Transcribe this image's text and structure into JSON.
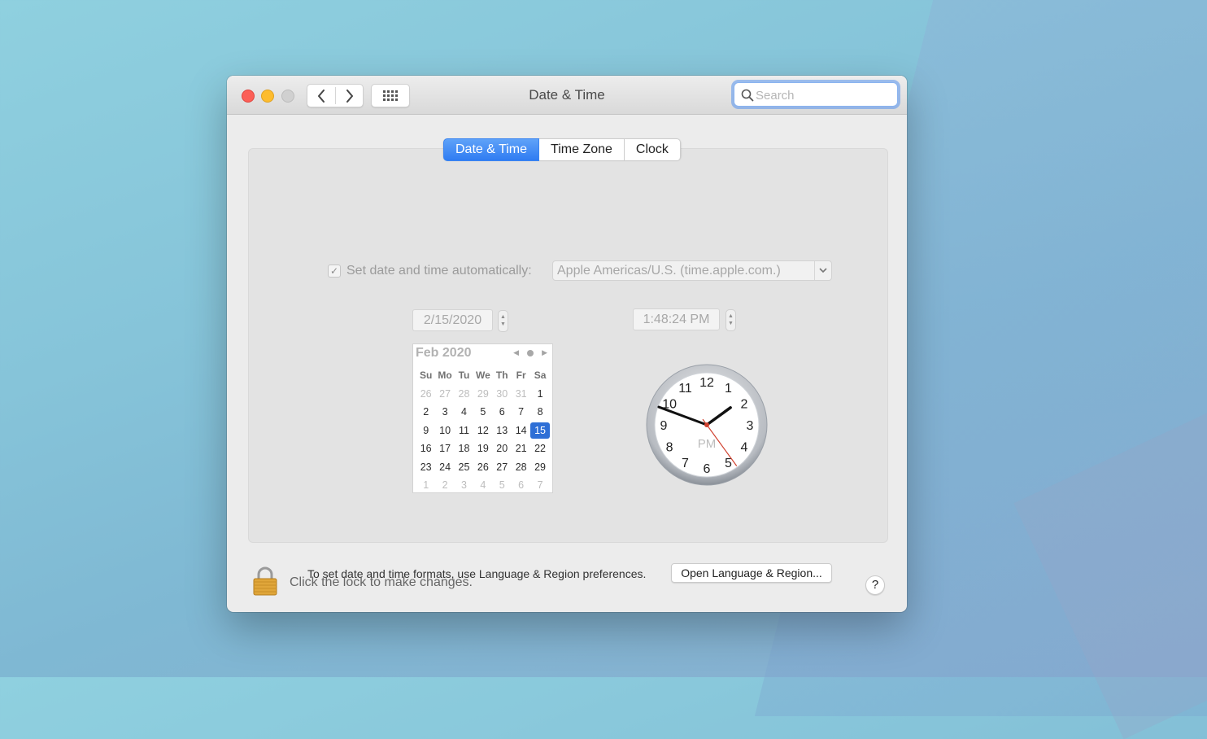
{
  "window": {
    "title": "Date & Time"
  },
  "search": {
    "placeholder": "Search"
  },
  "tabs": [
    {
      "label": "Date & Time",
      "active": true
    },
    {
      "label": "Time Zone",
      "active": false
    },
    {
      "label": "Clock",
      "active": false
    }
  ],
  "auto": {
    "checked": true,
    "label": "Set date and time automatically:",
    "server": "Apple Americas/U.S. (time.apple.com.)"
  },
  "date_field": "2/15/2020",
  "time_field": "1:48:24 PM",
  "calendar": {
    "month_label": "Feb 2020",
    "weekdays": [
      "Su",
      "Mo",
      "Tu",
      "We",
      "Th",
      "Fr",
      "Sa"
    ],
    "days": [
      [
        "26",
        "27",
        "28",
        "29",
        "30",
        "31",
        "1"
      ],
      [
        "2",
        "3",
        "4",
        "5",
        "6",
        "7",
        "8"
      ],
      [
        "9",
        "10",
        "11",
        "12",
        "13",
        "14",
        "15"
      ],
      [
        "16",
        "17",
        "18",
        "19",
        "20",
        "21",
        "22"
      ],
      [
        "23",
        "24",
        "25",
        "26",
        "27",
        "28",
        "29"
      ],
      [
        "1",
        "2",
        "3",
        "4",
        "5",
        "6",
        "7"
      ]
    ],
    "selected_day": "15"
  },
  "clock": {
    "numbers": [
      "12",
      "1",
      "2",
      "3",
      "4",
      "5",
      "6",
      "7",
      "8",
      "9",
      "10",
      "11"
    ],
    "period": "PM",
    "hour": 1,
    "minute": 48,
    "second": 24
  },
  "formats": {
    "text": "To set date and time formats, use Language & Region preferences.",
    "button": "Open Language & Region..."
  },
  "lock_text": "Click the lock to make changes.",
  "help": "?",
  "colors": {
    "accent": "#2f7cf2",
    "selected_day": "#2e6fd6",
    "second_hand": "#d0412f"
  }
}
